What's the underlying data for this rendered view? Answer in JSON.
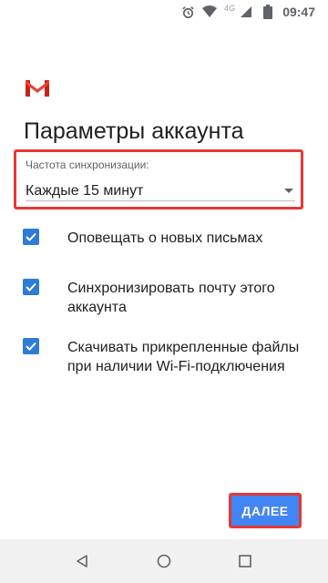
{
  "status_bar": {
    "time": "09:47",
    "network": "4G",
    "icons": [
      "alarm-icon",
      "wifi-icon",
      "signal-icon",
      "battery-icon"
    ]
  },
  "app": {
    "logo_icon": "gmail-logo-icon",
    "title": "Параметры аккаунта"
  },
  "sync": {
    "label": "Частота синхронизации:",
    "value": "Каждые 15 минут",
    "highlight_color": "#e53935"
  },
  "options": [
    {
      "label": "Оповещать о новых письмах",
      "checked": true
    },
    {
      "label": "Синхронизировать почту этого аккаунта",
      "checked": true
    },
    {
      "label": "Скачивать прикрепленные файлы при наличии Wi-Fi-подключения",
      "checked": true
    }
  ],
  "footer": {
    "next_label": "ДАЛЕЕ",
    "accent_color": "#4285f4"
  },
  "nav": {
    "icons": [
      "back-icon",
      "home-icon",
      "recents-icon"
    ]
  }
}
